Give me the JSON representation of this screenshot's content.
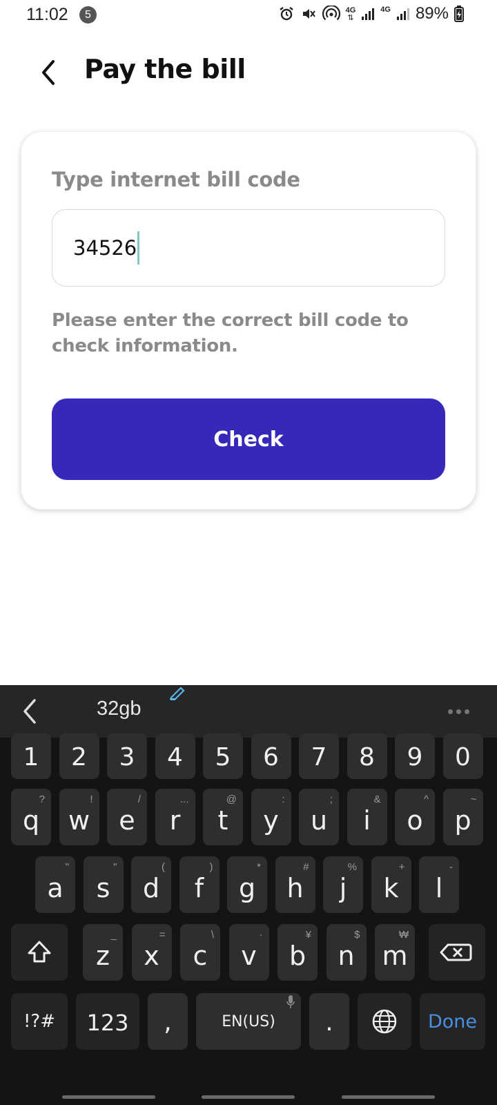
{
  "status": {
    "time": "11:02",
    "notif_count": "5",
    "net1": "4G",
    "net2": "4G",
    "battery": "89%"
  },
  "header": {
    "title": "Pay the bill"
  },
  "form": {
    "label": "Type internet bill code",
    "code_value": "34526",
    "hint": "Please enter the correct bill code to check information.",
    "check_label": "Check"
  },
  "keyboard": {
    "suggestion": "32gb",
    "number_row": [
      "1",
      "2",
      "3",
      "4",
      "5",
      "6",
      "7",
      "8",
      "9",
      "0"
    ],
    "row1": [
      {
        "k": "q",
        "s": "?"
      },
      {
        "k": "w",
        "s": "!"
      },
      {
        "k": "e",
        "s": "/"
      },
      {
        "k": "r",
        "s": "..."
      },
      {
        "k": "t",
        "s": "@"
      },
      {
        "k": "y",
        "s": ":"
      },
      {
        "k": "u",
        "s": ";"
      },
      {
        "k": "i",
        "s": "&"
      },
      {
        "k": "o",
        "s": "^"
      },
      {
        "k": "p",
        "s": "~"
      }
    ],
    "row2": [
      {
        "k": "a",
        "s": "\""
      },
      {
        "k": "s",
        "s": "\""
      },
      {
        "k": "d",
        "s": "("
      },
      {
        "k": "f",
        "s": ")"
      },
      {
        "k": "g",
        "s": "*"
      },
      {
        "k": "h",
        "s": "#"
      },
      {
        "k": "j",
        "s": "%"
      },
      {
        "k": "k",
        "s": "+"
      },
      {
        "k": "l",
        "s": "-"
      }
    ],
    "row3": [
      {
        "k": "z",
        "s": "_"
      },
      {
        "k": "x",
        "s": "="
      },
      {
        "k": "c",
        "s": "\\"
      },
      {
        "k": "v",
        "s": "·"
      },
      {
        "k": "b",
        "s": "¥"
      },
      {
        "k": "n",
        "s": "$"
      },
      {
        "k": "m",
        "s": "₩"
      }
    ],
    "symbols_label": "!?#",
    "num_label": "123",
    "comma_label": ",",
    "space_label": "EN(US)",
    "period_label": ".",
    "done_label": "Done",
    "done_color": "#4a90e2"
  },
  "colors": {
    "primary": "#3628b8",
    "caret": "#7ec9c4"
  }
}
